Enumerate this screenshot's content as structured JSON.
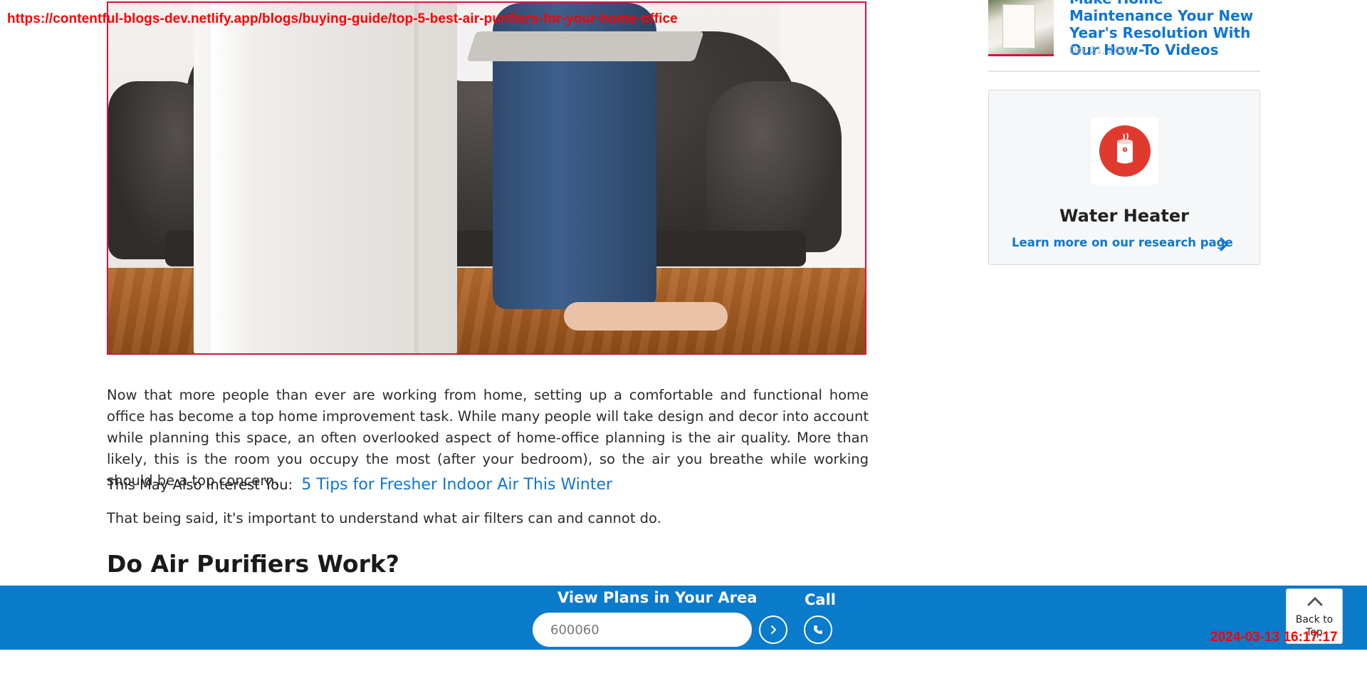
{
  "overlay": {
    "url": "https://contentful-blogs-dev.netlify.app/blogs/buying-guide/top-5-best-air-purifiers-for-your-home-office",
    "timestamp": "2024-03-13 16:17:17"
  },
  "article": {
    "paragraph1": "Now that more people than ever are working from home, setting up a comfortable and functional home office has become a top home improvement task. While many people will take design and decor into account while planning this space, an often overlooked aspect of home-office planning is the air quality. More than likely, this is the room you occupy the most (after your bedroom), so the air you breathe while working should be a top concern.",
    "interest_label": "This May Also Interest You:",
    "interest_link": "5 Tips for Fresher Indoor Air This Winter",
    "paragraph2": "That being said, it's important to understand what air filters can and cannot do.",
    "heading": "Do Air Purifiers Work?"
  },
  "sidebar": {
    "related": {
      "title": "Make Home Maintenance Your New Year's Resolution With Our How-To Videos",
      "date": "Dec 21, 2021"
    },
    "card": {
      "icon": "water-heater-icon",
      "title": "Water Heater",
      "link": "Learn more on our research page"
    }
  },
  "bottom_bar": {
    "title": "View Plans in Your Area",
    "zip_value": "600060",
    "call_label": "Call"
  },
  "back_to_top": "Back to Top",
  "colors": {
    "brand_blue": "#0b7bcb",
    "link_blue": "#0f76d2",
    "accent_red": "#d4143b",
    "overlay_red": "#ff0000"
  }
}
